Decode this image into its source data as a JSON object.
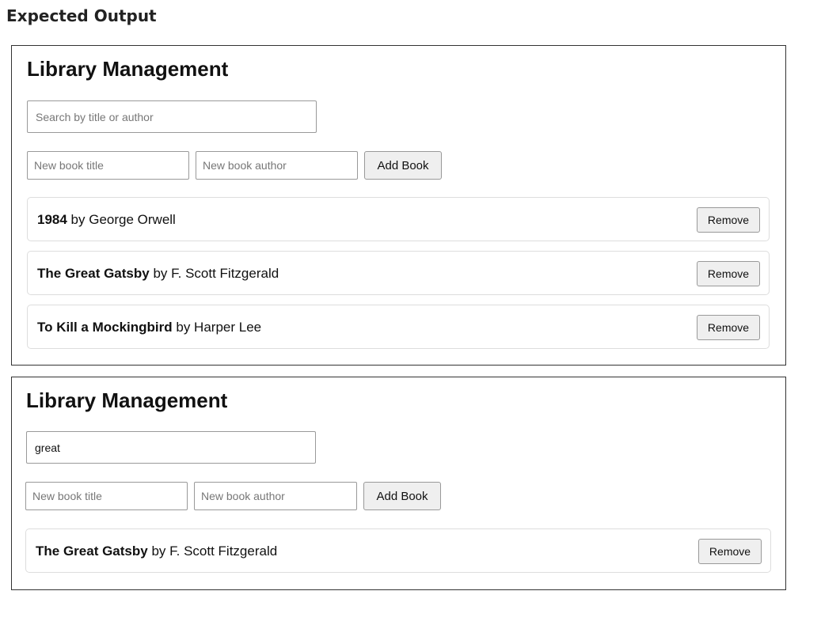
{
  "page_heading": "Expected Output",
  "panels": [
    {
      "title": "Library Management",
      "search": {
        "value": "",
        "placeholder": "Search by title or author"
      },
      "new_title_placeholder": "New book title",
      "new_author_placeholder": "New book author",
      "add_label": "Add Book",
      "books": [
        {
          "title": "1984",
          "by": " by ",
          "author": "George Orwell",
          "remove_label": "Remove"
        },
        {
          "title": "The Great Gatsby",
          "by": " by ",
          "author": "F. Scott Fitzgerald",
          "remove_label": "Remove"
        },
        {
          "title": "To Kill a Mockingbird",
          "by": " by ",
          "author": "Harper Lee",
          "remove_label": "Remove"
        }
      ]
    },
    {
      "title": "Library Management",
      "search": {
        "value": "great",
        "placeholder": "Search by title or author"
      },
      "new_title_placeholder": "New book title",
      "new_author_placeholder": "New book author",
      "add_label": "Add Book",
      "books": [
        {
          "title": "The Great Gatsby",
          "by": " by ",
          "author": "F. Scott Fitzgerald",
          "remove_label": "Remove"
        }
      ]
    }
  ]
}
